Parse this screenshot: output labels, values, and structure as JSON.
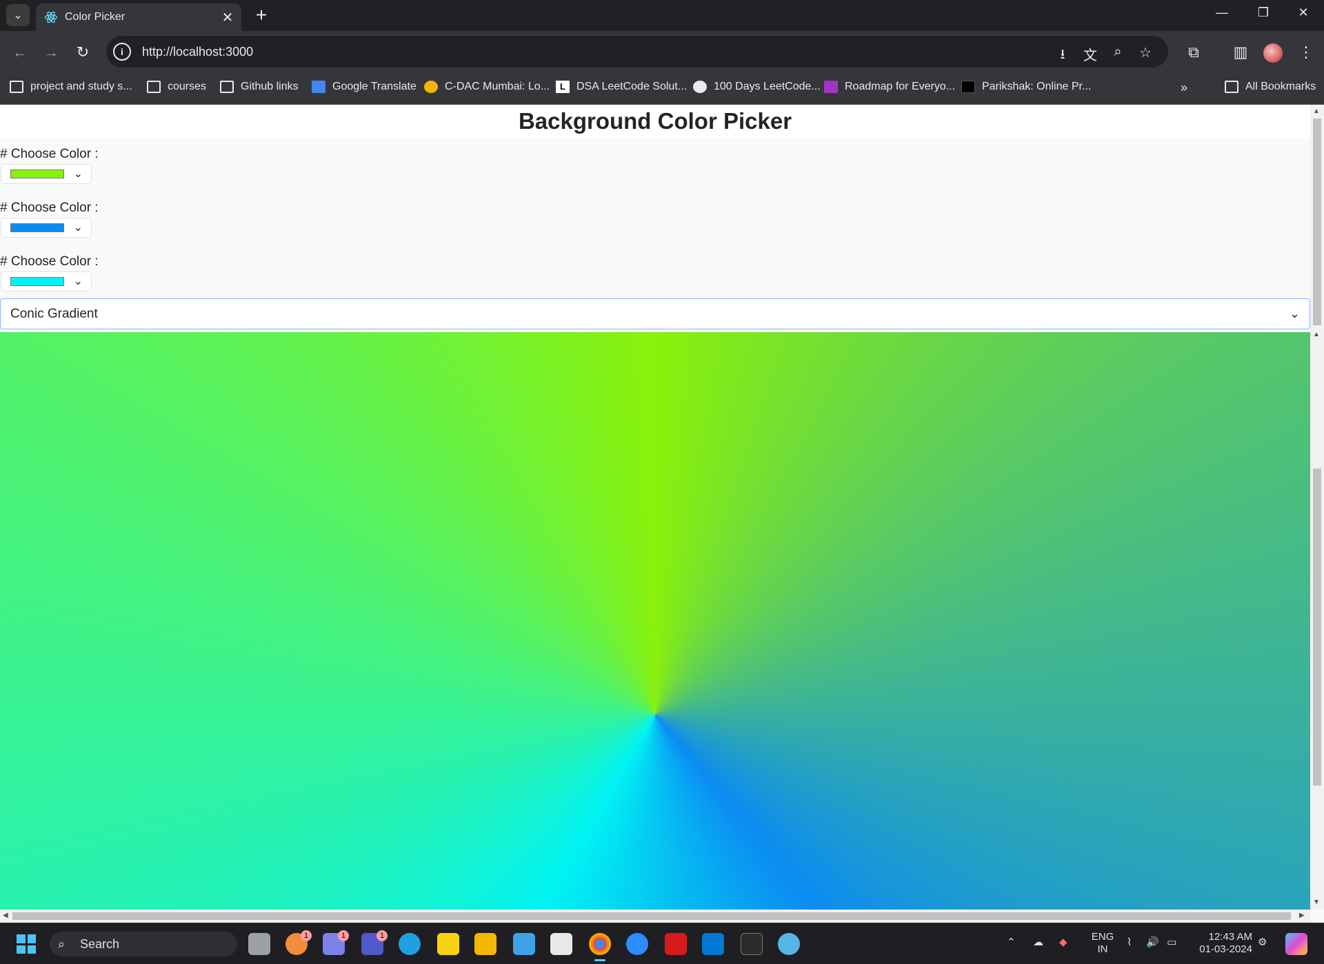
{
  "browser": {
    "tab_title": "Color Picker",
    "url": "http://localhost:3000",
    "bookmarks": [
      {
        "label": "project and study s...",
        "icon": "folder-icon"
      },
      {
        "label": "courses",
        "icon": "folder-icon"
      },
      {
        "label": "Github links",
        "icon": "folder-icon"
      },
      {
        "label": "Google Translate",
        "icon": "google-translate-icon"
      },
      {
        "label": "C-DAC Mumbai: Lo...",
        "icon": "cdac-icon"
      },
      {
        "label": "DSA LeetCode Solut...",
        "icon": "letter-l-icon"
      },
      {
        "label": "100 Days LeetCode...",
        "icon": "leetcode-icon"
      },
      {
        "label": "Roadmap for Everyo...",
        "icon": "roadmap-icon"
      },
      {
        "label": "Parikshak: Online Pr...",
        "icon": "terminal-icon"
      }
    ],
    "all_bookmarks": "All Bookmarks",
    "overflow_icon": "double-chevron-icon"
  },
  "page": {
    "heading": "Background Color Picker",
    "pickers": [
      {
        "label": "# Choose Color :",
        "color": "#8af10a"
      },
      {
        "label": "# Choose Color :",
        "color": "#0b8cf2"
      },
      {
        "label": "# Choose Color :",
        "color": "#00f3f3"
      }
    ],
    "gradient_select": {
      "selected": "Conic Gradient"
    }
  },
  "taskbar": {
    "search_placeholder": "Search",
    "language": "ENG",
    "region": "IN",
    "time": "12:43 AM",
    "date": "01-03-2024",
    "badges": {
      "photos": "1",
      "chat": "1",
      "teams": "1"
    }
  }
}
